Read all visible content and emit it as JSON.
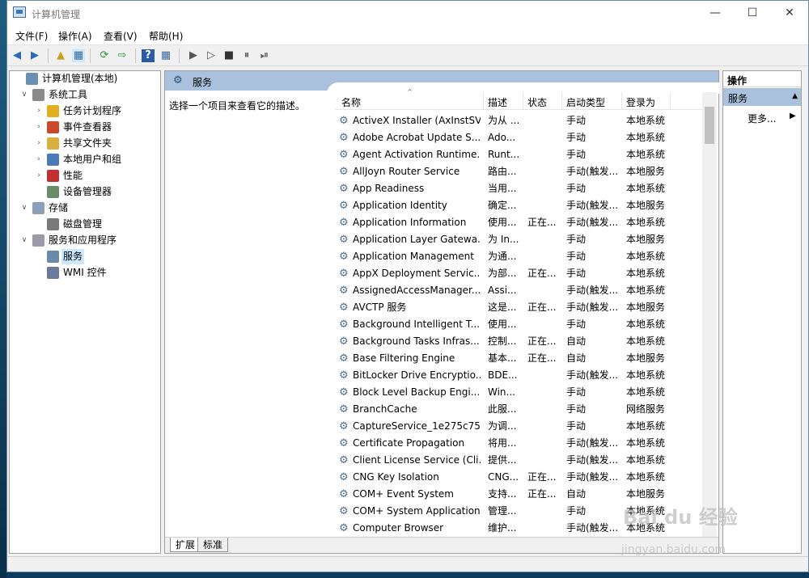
{
  "window": {
    "title": "计算机管理",
    "minimize": "—",
    "maximize": "☐",
    "close": "✕"
  },
  "menu": [
    "文件(F)",
    "操作(A)",
    "查看(V)",
    "帮助(H)"
  ],
  "toolbar": {
    "back": "◀",
    "forward": "▶",
    "up": "▲",
    "show_tree": "▦",
    "refresh": "⟳",
    "export": "⇨",
    "help": "?",
    "props": "▦",
    "play": "▶",
    "play2": "▷",
    "stop": "■",
    "pause": "⏸",
    "restart": "⏯"
  },
  "tree": [
    {
      "label": "计算机管理(本地)",
      "arrow": "",
      "icon": "computer-icon",
      "color": "#6b8fb3"
    },
    {
      "label": "系统工具",
      "arrow": "∨",
      "icon": "tools-icon",
      "color": "#8a8a8a"
    },
    {
      "label": "任务计划程序",
      "arrow": "›",
      "icon": "clock-icon",
      "color": "#e0b020"
    },
    {
      "label": "事件查看器",
      "arrow": "›",
      "icon": "event-viewer-icon",
      "color": "#c84a2a"
    },
    {
      "label": "共享文件夹",
      "arrow": "›",
      "icon": "shared-folder-icon",
      "color": "#d8b040"
    },
    {
      "label": "本地用户和组",
      "arrow": "›",
      "icon": "users-icon",
      "color": "#4a7ab8"
    },
    {
      "label": "性能",
      "arrow": "›",
      "icon": "performance-icon",
      "color": "#c03030"
    },
    {
      "label": "设备管理器",
      "arrow": "",
      "icon": "device-manager-icon",
      "color": "#6a8a6a"
    },
    {
      "label": "存储",
      "arrow": "∨",
      "icon": "storage-icon",
      "color": "#8aa0b8"
    },
    {
      "label": "磁盘管理",
      "arrow": "",
      "icon": "disk-icon",
      "color": "#7a7a7a"
    },
    {
      "label": "服务和应用程序",
      "arrow": "∨",
      "icon": "services-apps-icon",
      "color": "#9a9aa8"
    },
    {
      "label": "服务",
      "arrow": "",
      "icon": "services-icon",
      "color": "#6a8aaa"
    },
    {
      "label": "WMI 控件",
      "arrow": "",
      "icon": "wmi-icon",
      "color": "#6a7a9a"
    }
  ],
  "center": {
    "header": "服务",
    "description": "选择一个项目来查看它的描述。",
    "sort_indicator": "⌃"
  },
  "columns": {
    "name": "名称",
    "desc": "描述",
    "status": "状态",
    "startup": "启动类型",
    "logon": "登录为"
  },
  "services": [
    [
      "ActiveX Installer (AxInstSV)",
      "为从 ...",
      "",
      "手动",
      "本地系统"
    ],
    [
      "Adobe Acrobat Update S...",
      "Ado...",
      "",
      "手动",
      "本地系统"
    ],
    [
      "Agent Activation Runtime...",
      "Runt...",
      "",
      "手动",
      "本地系统"
    ],
    [
      "AllJoyn Router Service",
      "路由...",
      "",
      "手动(触发...",
      "本地服务"
    ],
    [
      "App Readiness",
      "当用...",
      "",
      "手动",
      "本地系统"
    ],
    [
      "Application Identity",
      "确定...",
      "",
      "手动(触发...",
      "本地服务"
    ],
    [
      "Application Information",
      "使用...",
      "正在...",
      "手动(触发...",
      "本地系统"
    ],
    [
      "Application Layer Gatewa...",
      "为 In...",
      "",
      "手动",
      "本地服务"
    ],
    [
      "Application Management",
      "为通...",
      "",
      "手动",
      "本地系统"
    ],
    [
      "AppX Deployment Servic...",
      "为部...",
      "正在...",
      "手动",
      "本地系统"
    ],
    [
      "AssignedAccessManager...",
      "Assi...",
      "",
      "手动(触发...",
      "本地系统"
    ],
    [
      "AVCTP 服务",
      "这是...",
      "正在...",
      "手动(触发...",
      "本地服务"
    ],
    [
      "Background Intelligent T...",
      "使用...",
      "",
      "手动",
      "本地系统"
    ],
    [
      "Background Tasks Infras...",
      "控制...",
      "正在...",
      "自动",
      "本地系统"
    ],
    [
      "Base Filtering Engine",
      "基本...",
      "正在...",
      "自动",
      "本地服务"
    ],
    [
      "BitLocker Drive Encryptio...",
      "BDE...",
      "",
      "手动(触发...",
      "本地系统"
    ],
    [
      "Block Level Backup Engi...",
      "Win...",
      "",
      "手动",
      "本地系统"
    ],
    [
      "BranchCache",
      "此服...",
      "",
      "手动",
      "网络服务"
    ],
    [
      "CaptureService_1e275c75",
      "为调...",
      "",
      "手动",
      "本地系统"
    ],
    [
      "Certificate Propagation",
      "将用...",
      "",
      "手动(触发...",
      "本地系统"
    ],
    [
      "Client License Service (Cli...",
      "提供...",
      "",
      "手动(触发...",
      "本地系统"
    ],
    [
      "CNG Key Isolation",
      "CNG...",
      "正在...",
      "手动(触发...",
      "本地系统"
    ],
    [
      "COM+ Event System",
      "支持...",
      "正在...",
      "自动",
      "本地服务"
    ],
    [
      "COM+ System Application",
      "管理...",
      "",
      "手动",
      "本地系统"
    ],
    [
      "Computer Browser",
      "维护...",
      "",
      "手动(触发...",
      "本地系统"
    ]
  ],
  "tabs": [
    "扩展",
    "标准"
  ],
  "actions": {
    "header": "操作",
    "section": "服务",
    "section_chev": "▲",
    "more": "更多...",
    "more_chev": "▶"
  },
  "watermark": {
    "text": "Bai du 经验",
    "url": "jingyan.baidu.com"
  }
}
